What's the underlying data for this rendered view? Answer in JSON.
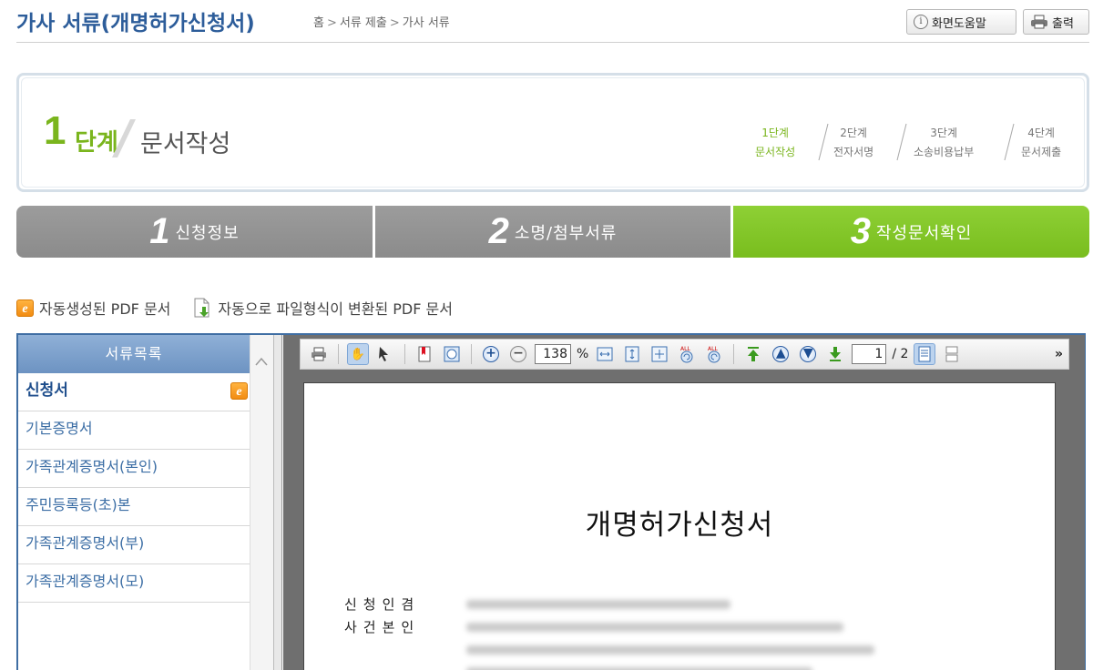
{
  "header": {
    "title": "가사 서류(개명허가신청서)",
    "breadcrumb": [
      "홈",
      "서류 제출",
      "가사 서류"
    ],
    "breadcrumb_sep": ">",
    "help_label": "화면도움말",
    "print_label": "출력"
  },
  "step_banner": {
    "number": "1",
    "step_word": "단계",
    "step_title": "문서작성",
    "steps": [
      {
        "num": "1단계",
        "name": "문서작성",
        "active": true
      },
      {
        "num": "2단계",
        "name": "전자서명",
        "active": false
      },
      {
        "num": "3단계",
        "name": "소송비용납부",
        "active": false
      },
      {
        "num": "4단계",
        "name": "문서제출",
        "active": false
      }
    ]
  },
  "tabs": [
    {
      "num": "1",
      "label": "신청정보",
      "active": false
    },
    {
      "num": "2",
      "label": "소명/첨부서류",
      "active": false
    },
    {
      "num": "3",
      "label": "작성문서확인",
      "active": true
    }
  ],
  "legend": {
    "auto_pdf": "자동생성된 PDF 문서",
    "converted_pdf": "자동으로 파일형식이 변환된 PDF 문서"
  },
  "sidebar": {
    "header": "서류목록",
    "items": [
      {
        "label": "신청서",
        "selected": true
      },
      {
        "label": "기본증명서"
      },
      {
        "label": "가족관계증명서(본인)"
      },
      {
        "label": "주민등록등(초)본"
      },
      {
        "label": "가족관계증명서(부)"
      },
      {
        "label": "가족관계증명서(모)"
      }
    ]
  },
  "viewer": {
    "zoom": "138",
    "zoom_unit": "%",
    "page_current": "1",
    "page_total": "/ 2",
    "more": "»",
    "document": {
      "title": "개명허가신청서",
      "labels": [
        "신청인겸",
        "사건본인"
      ]
    }
  },
  "colors": {
    "title_blue": "#2d5d9a",
    "green": "#7ab51d",
    "tab_grey": "#939393",
    "panel_border": "#3f6ea3"
  }
}
